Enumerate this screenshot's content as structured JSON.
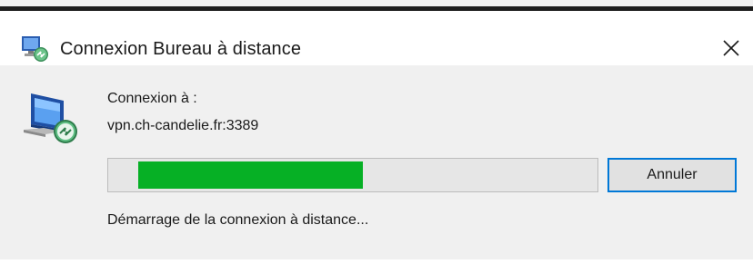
{
  "window": {
    "title": "Connexion Bureau à distance",
    "title_icon": "remote-desktop-icon",
    "close_icon": "close-icon"
  },
  "dialog": {
    "connecting_label": "Connexion à :",
    "server": "vpn.ch-candelie.fr:3389",
    "progress_fraction": 0.46,
    "cancel_label": "Annuler",
    "status": "Démarrage de la connexion à distance..."
  },
  "colors": {
    "progress_fill": "#06b025",
    "button_border": "#0078d7",
    "background": "#f0f0f0"
  }
}
